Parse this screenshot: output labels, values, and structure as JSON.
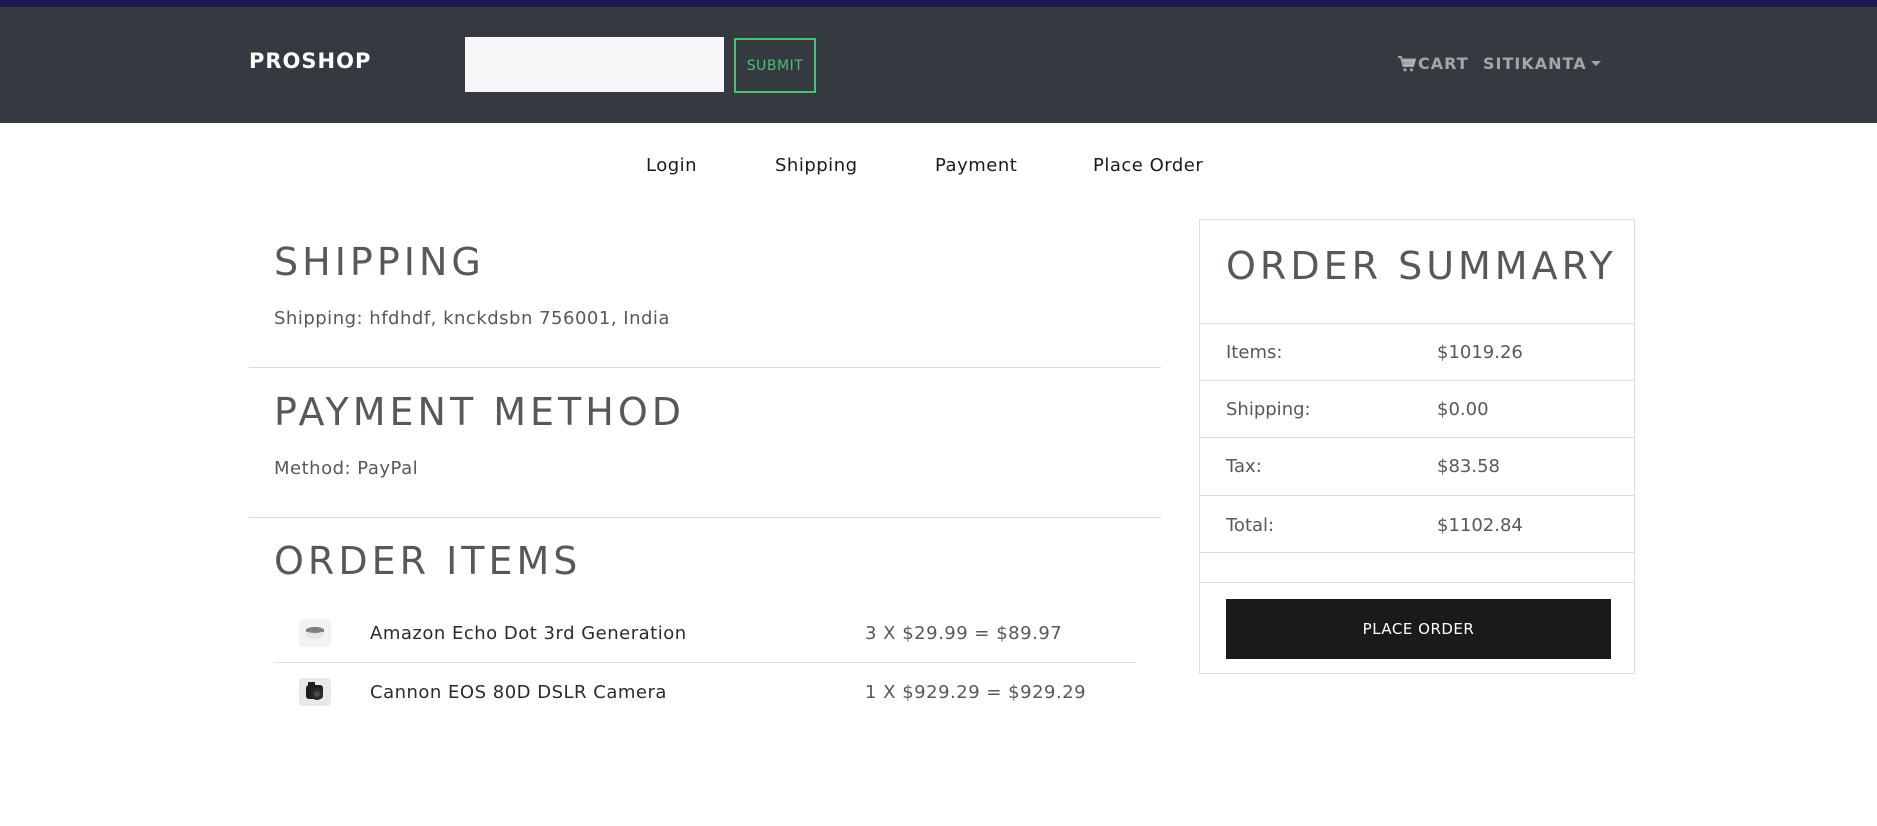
{
  "header": {
    "brand": "PROSHOP",
    "search": {
      "value": "",
      "placeholder": ""
    },
    "submit_label": "SUBMIT",
    "cart_label": "CART",
    "user_label": "SITIKANTA"
  },
  "checkout_steps": [
    "Login",
    "Shipping",
    "Payment",
    "Place Order"
  ],
  "shipping": {
    "title": "SHIPPING",
    "text": "Shipping: hfdhdf, knckdsbn 756001, India"
  },
  "payment": {
    "title": "PAYMENT METHOD",
    "text": "Method: PayPal"
  },
  "order_items": {
    "title": "ORDER ITEMS",
    "items": [
      {
        "name": "Amazon Echo Dot 3rd Generation",
        "price": "3 X $29.99 = $89.97"
      },
      {
        "name": "Cannon EOS 80D DSLR Camera",
        "price": "1 X $929.29 = $929.29"
      }
    ]
  },
  "summary": {
    "title": "ORDER SUMMARY",
    "rows": [
      {
        "label": "Items:",
        "value": "$1019.26"
      },
      {
        "label": "Shipping:",
        "value": "$0.00"
      },
      {
        "label": "Tax:",
        "value": "$83.58"
      },
      {
        "label": "Total:",
        "value": "$1102.84"
      }
    ],
    "button_label": "PLACE ORDER"
  },
  "icons": {
    "cart": "cart-icon",
    "caret": "chevron-down-icon"
  },
  "colors": {
    "navbar": "#343a40",
    "accent": "#4bbf73",
    "button": "#1a1a1a"
  }
}
